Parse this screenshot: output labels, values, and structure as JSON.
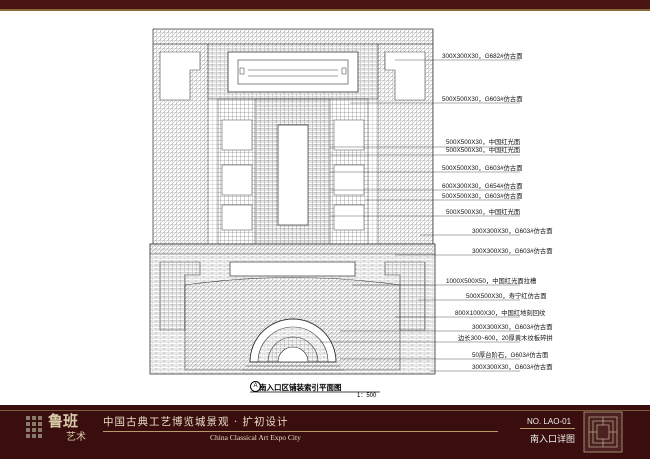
{
  "drawing": {
    "caption_marker": "A",
    "caption": "南入口区铺装索引平面图",
    "scale": "1：500",
    "callouts": [
      "300X300X30，G682#仿古面",
      "500X500X30，G603#仿古面",
      "500X500X30，中国红光面",
      "500X500X30，中国红光面",
      "500X500X30，G603#仿古面",
      "600X300X30，G654#仿古面",
      "500X500X30，G603#仿古面",
      "500X500X30，中国红光面",
      "300X300X30，G603#仿古面",
      "300X300X30，G603#仿古面",
      "1000X500X50，中国红光面拉槽",
      "500X500X30，寿宁红仿古面",
      "800X1000X30，中国红地刻回纹",
      "300X300X30，G603#仿古面",
      "边长300~600，20厚黄木纹板碎拼",
      "50厚台阶石，G603#仿古面",
      "300X300X30，G603#仿古面"
    ]
  },
  "titleblock": {
    "logo_main": "鲁班",
    "logo_sub": "艺术",
    "title_cn": "中国古典工艺博览城景观 · 扩初设计",
    "title_en": "China Classical Art Expo City",
    "sheet_number": "NO. LAO-01",
    "sheet_name": "南入口详图"
  },
  "colors": {
    "frame_dark": "#3a0e0e",
    "accent_gold": "#b89a6a",
    "line_ink": "#333333"
  }
}
